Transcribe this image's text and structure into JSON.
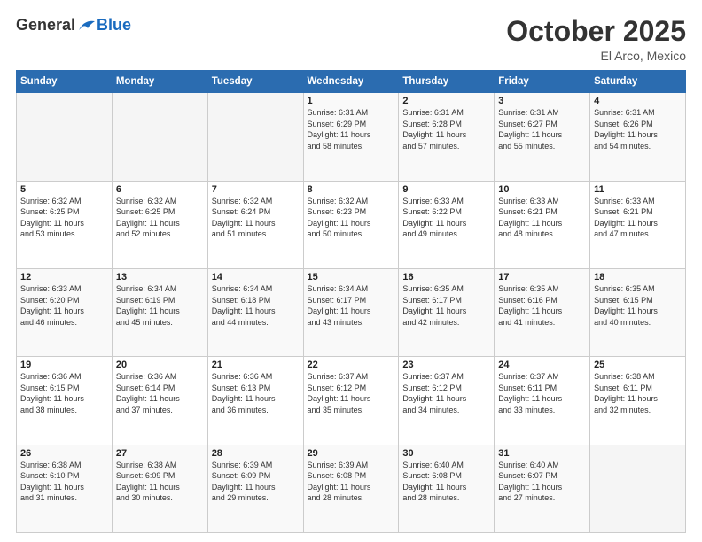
{
  "header": {
    "logo": {
      "general": "General",
      "blue": "Blue"
    },
    "title": "October 2025",
    "location": "El Arco, Mexico"
  },
  "calendar": {
    "headers": [
      "Sunday",
      "Monday",
      "Tuesday",
      "Wednesday",
      "Thursday",
      "Friday",
      "Saturday"
    ],
    "weeks": [
      [
        {
          "day": "",
          "info": ""
        },
        {
          "day": "",
          "info": ""
        },
        {
          "day": "",
          "info": ""
        },
        {
          "day": "1",
          "info": "Sunrise: 6:31 AM\nSunset: 6:29 PM\nDaylight: 11 hours\nand 58 minutes."
        },
        {
          "day": "2",
          "info": "Sunrise: 6:31 AM\nSunset: 6:28 PM\nDaylight: 11 hours\nand 57 minutes."
        },
        {
          "day": "3",
          "info": "Sunrise: 6:31 AM\nSunset: 6:27 PM\nDaylight: 11 hours\nand 55 minutes."
        },
        {
          "day": "4",
          "info": "Sunrise: 6:31 AM\nSunset: 6:26 PM\nDaylight: 11 hours\nand 54 minutes."
        }
      ],
      [
        {
          "day": "5",
          "info": "Sunrise: 6:32 AM\nSunset: 6:25 PM\nDaylight: 11 hours\nand 53 minutes."
        },
        {
          "day": "6",
          "info": "Sunrise: 6:32 AM\nSunset: 6:25 PM\nDaylight: 11 hours\nand 52 minutes."
        },
        {
          "day": "7",
          "info": "Sunrise: 6:32 AM\nSunset: 6:24 PM\nDaylight: 11 hours\nand 51 minutes."
        },
        {
          "day": "8",
          "info": "Sunrise: 6:32 AM\nSunset: 6:23 PM\nDaylight: 11 hours\nand 50 minutes."
        },
        {
          "day": "9",
          "info": "Sunrise: 6:33 AM\nSunset: 6:22 PM\nDaylight: 11 hours\nand 49 minutes."
        },
        {
          "day": "10",
          "info": "Sunrise: 6:33 AM\nSunset: 6:21 PM\nDaylight: 11 hours\nand 48 minutes."
        },
        {
          "day": "11",
          "info": "Sunrise: 6:33 AM\nSunset: 6:21 PM\nDaylight: 11 hours\nand 47 minutes."
        }
      ],
      [
        {
          "day": "12",
          "info": "Sunrise: 6:33 AM\nSunset: 6:20 PM\nDaylight: 11 hours\nand 46 minutes."
        },
        {
          "day": "13",
          "info": "Sunrise: 6:34 AM\nSunset: 6:19 PM\nDaylight: 11 hours\nand 45 minutes."
        },
        {
          "day": "14",
          "info": "Sunrise: 6:34 AM\nSunset: 6:18 PM\nDaylight: 11 hours\nand 44 minutes."
        },
        {
          "day": "15",
          "info": "Sunrise: 6:34 AM\nSunset: 6:17 PM\nDaylight: 11 hours\nand 43 minutes."
        },
        {
          "day": "16",
          "info": "Sunrise: 6:35 AM\nSunset: 6:17 PM\nDaylight: 11 hours\nand 42 minutes."
        },
        {
          "day": "17",
          "info": "Sunrise: 6:35 AM\nSunset: 6:16 PM\nDaylight: 11 hours\nand 41 minutes."
        },
        {
          "day": "18",
          "info": "Sunrise: 6:35 AM\nSunset: 6:15 PM\nDaylight: 11 hours\nand 40 minutes."
        }
      ],
      [
        {
          "day": "19",
          "info": "Sunrise: 6:36 AM\nSunset: 6:15 PM\nDaylight: 11 hours\nand 38 minutes."
        },
        {
          "day": "20",
          "info": "Sunrise: 6:36 AM\nSunset: 6:14 PM\nDaylight: 11 hours\nand 37 minutes."
        },
        {
          "day": "21",
          "info": "Sunrise: 6:36 AM\nSunset: 6:13 PM\nDaylight: 11 hours\nand 36 minutes."
        },
        {
          "day": "22",
          "info": "Sunrise: 6:37 AM\nSunset: 6:12 PM\nDaylight: 11 hours\nand 35 minutes."
        },
        {
          "day": "23",
          "info": "Sunrise: 6:37 AM\nSunset: 6:12 PM\nDaylight: 11 hours\nand 34 minutes."
        },
        {
          "day": "24",
          "info": "Sunrise: 6:37 AM\nSunset: 6:11 PM\nDaylight: 11 hours\nand 33 minutes."
        },
        {
          "day": "25",
          "info": "Sunrise: 6:38 AM\nSunset: 6:11 PM\nDaylight: 11 hours\nand 32 minutes."
        }
      ],
      [
        {
          "day": "26",
          "info": "Sunrise: 6:38 AM\nSunset: 6:10 PM\nDaylight: 11 hours\nand 31 minutes."
        },
        {
          "day": "27",
          "info": "Sunrise: 6:38 AM\nSunset: 6:09 PM\nDaylight: 11 hours\nand 30 minutes."
        },
        {
          "day": "28",
          "info": "Sunrise: 6:39 AM\nSunset: 6:09 PM\nDaylight: 11 hours\nand 29 minutes."
        },
        {
          "day": "29",
          "info": "Sunrise: 6:39 AM\nSunset: 6:08 PM\nDaylight: 11 hours\nand 28 minutes."
        },
        {
          "day": "30",
          "info": "Sunrise: 6:40 AM\nSunset: 6:08 PM\nDaylight: 11 hours\nand 28 minutes."
        },
        {
          "day": "31",
          "info": "Sunrise: 6:40 AM\nSunset: 6:07 PM\nDaylight: 11 hours\nand 27 minutes."
        },
        {
          "day": "",
          "info": ""
        }
      ]
    ]
  }
}
